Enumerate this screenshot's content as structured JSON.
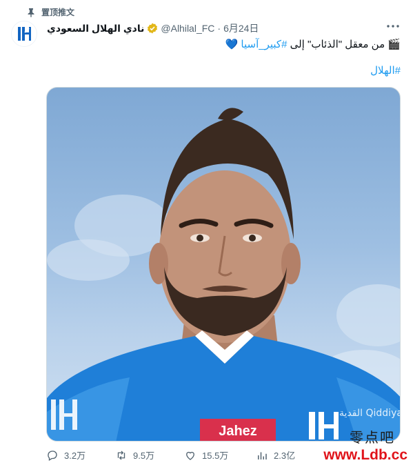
{
  "pinned": {
    "label": "置顶推文",
    "icon": "pin-icon"
  },
  "author": {
    "display_name": "نادي الهلال السعودي",
    "handle": "@Alhilal_FC",
    "separator": "·",
    "date": "6月24日",
    "avatar_icon": "alhilal-logo-icon",
    "verified_icon": "verified-gold-badge-icon"
  },
  "more_icon": "more-horizontal-icon",
  "tweet": {
    "text_prefix": "من معقل \"الذئاب\" إلى ",
    "hashtag": "#كبير_آسيا",
    "heart": "💙",
    "emoji_clapper": "🎬",
    "hashtag_line": "#الهلال"
  },
  "media": {
    "kind": "photo",
    "sponsor": "Jahez",
    "brand_badge": "القدية Qiddiya",
    "colors": {
      "sky": "#9ebfe2",
      "jersey": "#1f7fd8",
      "jersey_light": "#4aa3ec"
    }
  },
  "actions": {
    "reply": {
      "count": "3.2万",
      "icon": "reply-icon"
    },
    "retweet": {
      "count": "9.5万",
      "icon": "retweet-icon"
    },
    "like": {
      "count": "15.5万",
      "icon": "heart-outline-icon"
    },
    "views": {
      "count": "2.3亿",
      "icon": "views-bar-icon"
    }
  },
  "watermark": {
    "cn": "零点吧",
    "url": "www.Ldb.cc"
  },
  "colors": {
    "accent": "#1d9bf0",
    "muted": "#536471",
    "text": "#0f1419",
    "watermark_red": "#e0131a"
  }
}
